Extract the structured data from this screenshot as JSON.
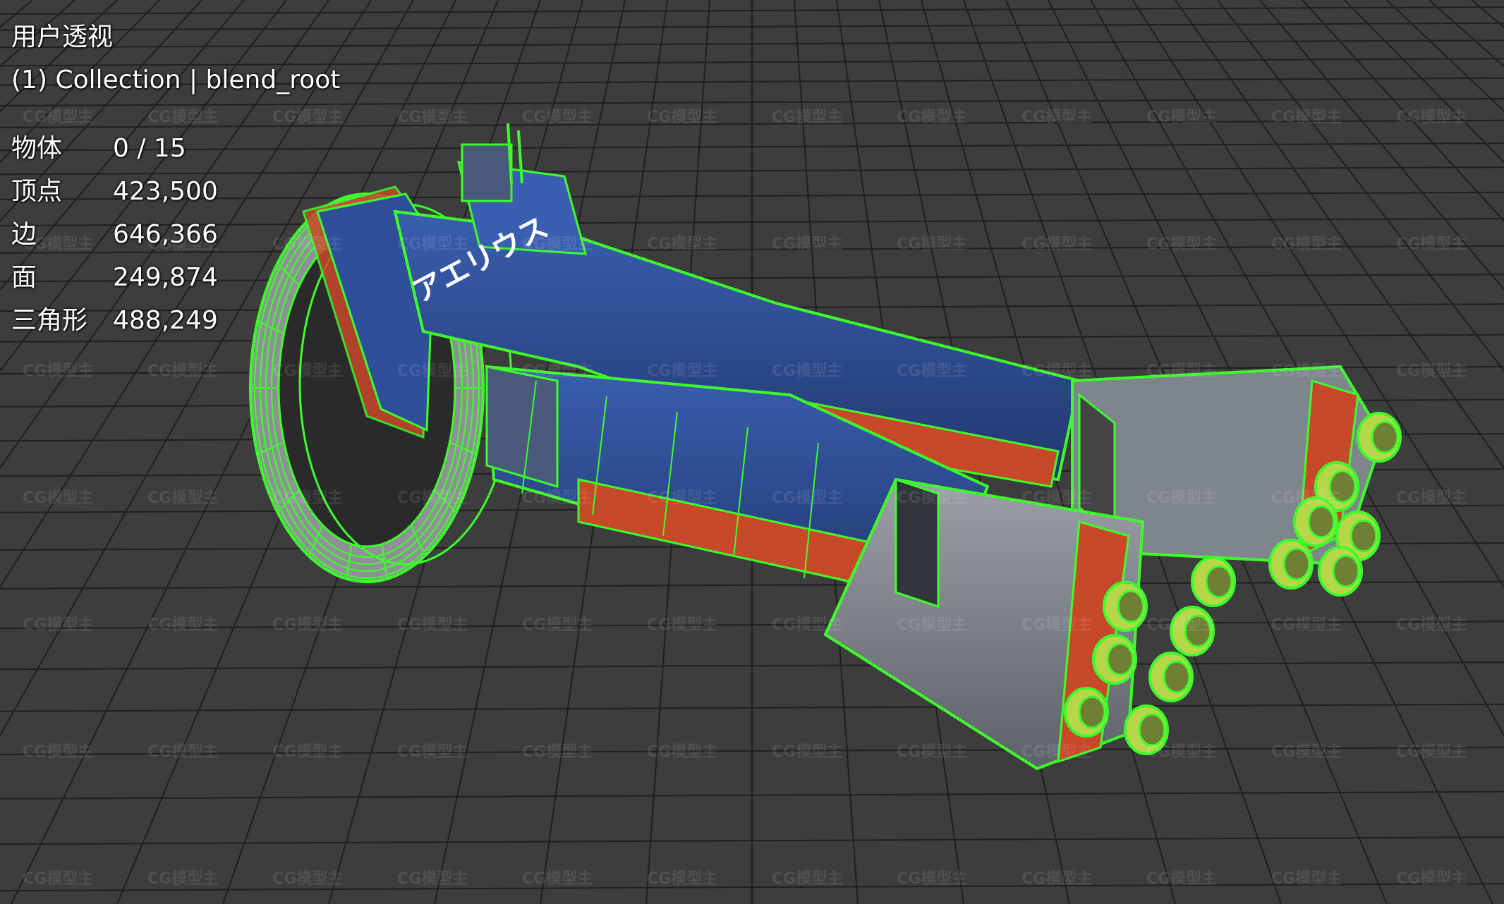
{
  "viewport": {
    "view_name": "用户透视",
    "collection": "(1) Collection | blend_root",
    "background_color": "#3d3d3d",
    "grid_color": "#1f1f1f",
    "wireframe_color": "#3cff2a"
  },
  "stats": [
    {
      "label": "物体",
      "value": "0 / 15"
    },
    {
      "label": "顶点",
      "value": "423,500"
    },
    {
      "label": "边",
      "value": "646,366"
    },
    {
      "label": "面",
      "value": "249,874"
    },
    {
      "label": "三角形",
      "value": "488,249"
    }
  ],
  "model": {
    "hull_text": "アエリウス",
    "hull_color": "#2f4f9a",
    "stripe_color": "#c8482a"
  },
  "watermark": "CG模型主"
}
